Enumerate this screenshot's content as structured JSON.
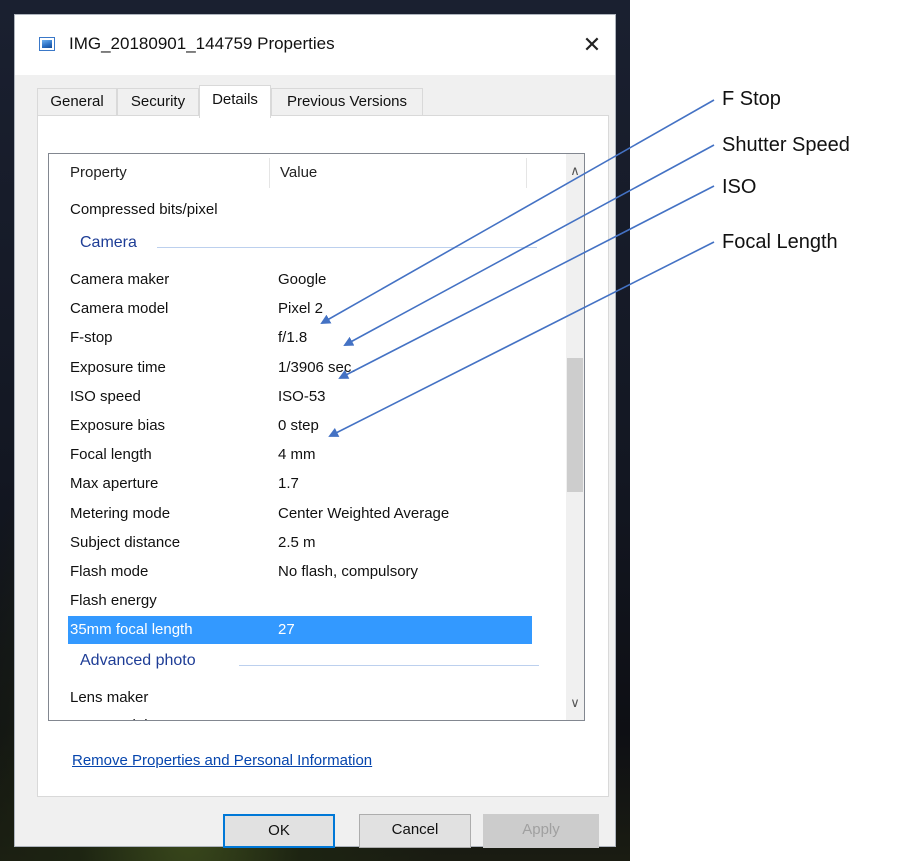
{
  "window": {
    "title": "IMG_20180901_144759 Properties",
    "close_symbol": "✕"
  },
  "tabs": [
    {
      "label": "General"
    },
    {
      "label": "Security"
    },
    {
      "label": "Details"
    },
    {
      "label": "Previous Versions"
    }
  ],
  "active_tab": "Details",
  "list": {
    "headers": {
      "property": "Property",
      "value": "Value"
    },
    "rows_top": [
      {
        "property": "Compressed bits/pixel",
        "value": ""
      }
    ],
    "group_camera": "Camera",
    "camera_rows": [
      {
        "property": "Camera maker",
        "value": "Google"
      },
      {
        "property": "Camera model",
        "value": "Pixel 2"
      },
      {
        "property": "F-stop",
        "value": "f/1.8"
      },
      {
        "property": "Exposure time",
        "value": "1/3906 sec."
      },
      {
        "property": "ISO speed",
        "value": "ISO-53"
      },
      {
        "property": "Exposure bias",
        "value": "0 step"
      },
      {
        "property": "Focal length",
        "value": "4 mm"
      },
      {
        "property": "Max aperture",
        "value": "1.7"
      },
      {
        "property": "Metering mode",
        "value": "Center Weighted Average"
      },
      {
        "property": "Subject distance",
        "value": "2.5 m"
      },
      {
        "property": "Flash mode",
        "value": "No flash, compulsory"
      },
      {
        "property": "Flash energy",
        "value": ""
      }
    ],
    "selected_row": {
      "property": "35mm focal length",
      "value": "27"
    },
    "group_advanced": "Advanced photo",
    "advanced_rows": [
      {
        "property": "Lens maker",
        "value": ""
      },
      {
        "property": "Lens model",
        "value": ""
      }
    ],
    "scroll_up_symbol": "∧",
    "scroll_down_symbol": "∨"
  },
  "remove_link": "Remove Properties and Personal Information",
  "buttons": {
    "ok": "OK",
    "cancel": "Cancel",
    "apply": "Apply"
  },
  "callouts": {
    "f_stop": "F Stop",
    "shutter_speed": "Shutter Speed",
    "iso": "ISO",
    "focal_length": "Focal Length"
  },
  "colors": {
    "selection": "#3399ff",
    "arrow": "#4472c4",
    "group_header": "#1e3d96",
    "link": "#0645ad"
  }
}
